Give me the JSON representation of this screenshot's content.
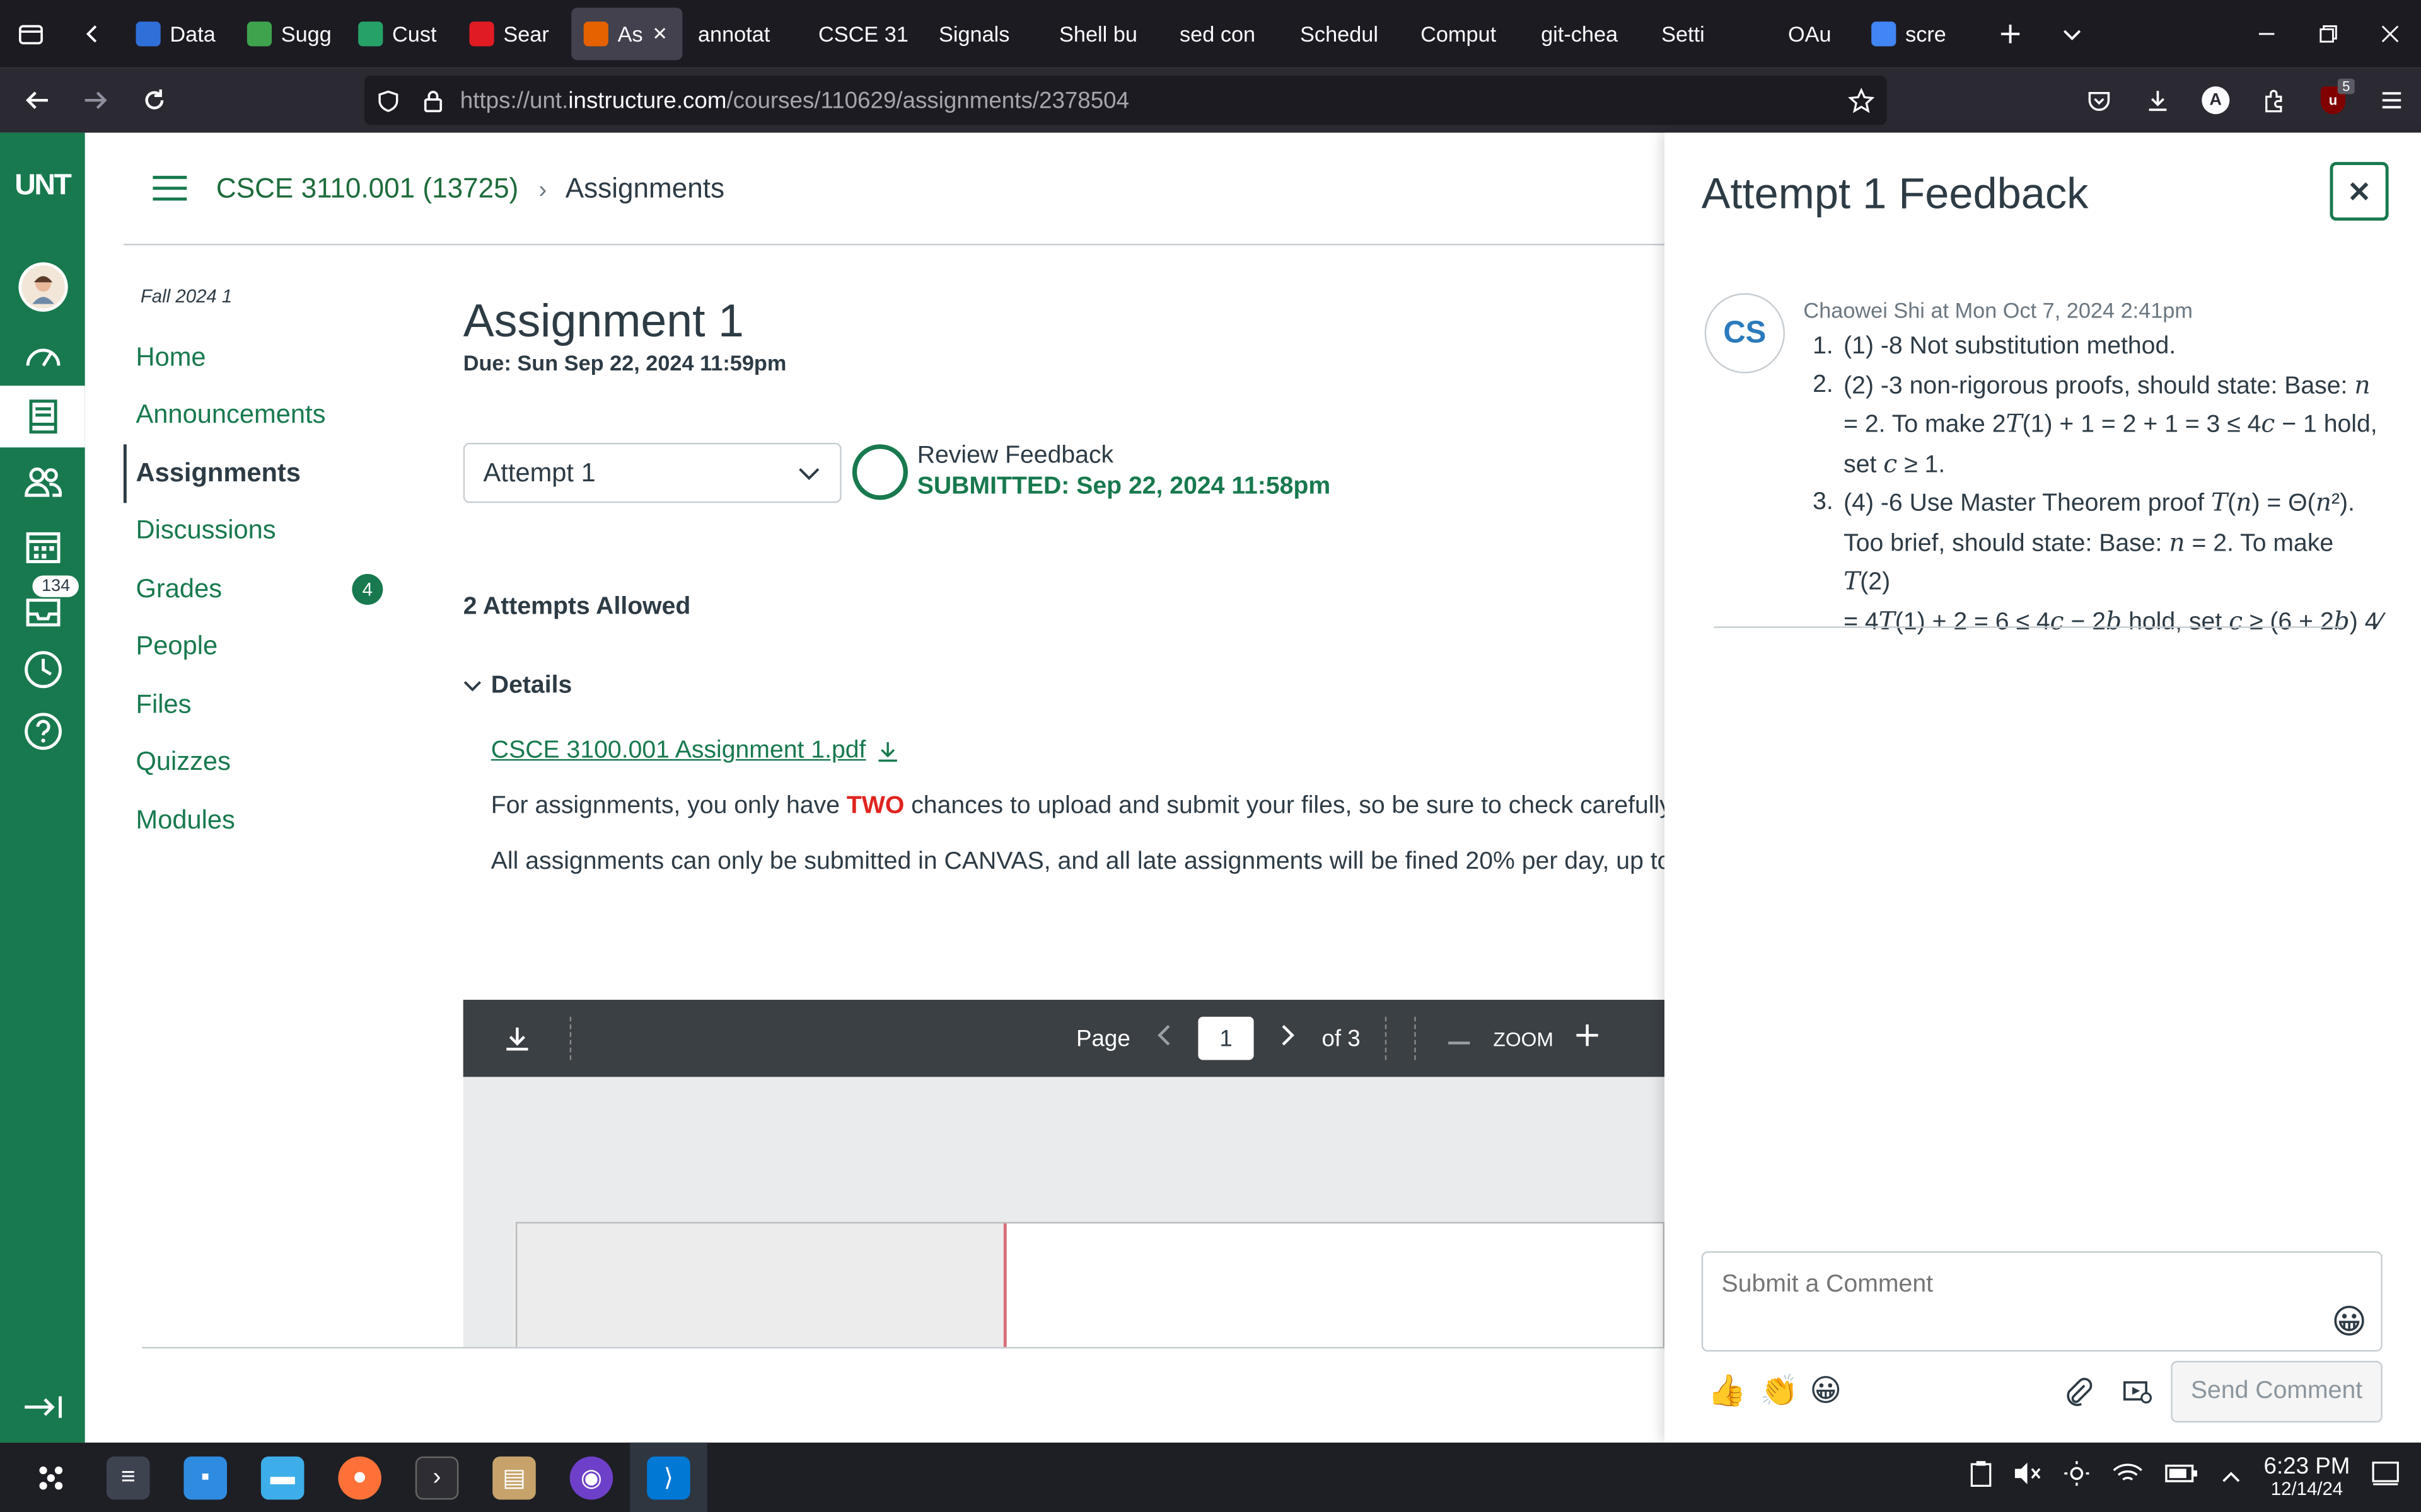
{
  "browser": {
    "tabs": [
      {
        "label": "Data",
        "color": "#2f6fd8"
      },
      {
        "label": "Sugg",
        "color": "#3fa34d"
      },
      {
        "label": "Cust",
        "color": "#26a269"
      },
      {
        "label": "Sear",
        "color": "#e01b24"
      },
      {
        "label": "As",
        "color": "#e66100",
        "active": true
      },
      {
        "label": "annotat",
        "color": ""
      },
      {
        "label": "CSCE 31",
        "color": ""
      },
      {
        "label": "Signals",
        "color": ""
      },
      {
        "label": "Shell bu",
        "color": ""
      },
      {
        "label": "sed con",
        "color": ""
      },
      {
        "label": "Schedul",
        "color": ""
      },
      {
        "label": "Comput",
        "color": ""
      },
      {
        "label": "git-chea",
        "color": ""
      },
      {
        "label": "Setti",
        "color": ""
      },
      {
        "label": "OAu",
        "color": ""
      },
      {
        "label": "scre",
        "color": "#4285f4"
      }
    ],
    "url_prefix": "https://unt.",
    "url_host": "instructure.com",
    "url_path": "/courses/110629/assignments/2378504",
    "notif_count": "5"
  },
  "global_nav": {
    "logo": "UNT",
    "inbox_count": "134"
  },
  "breadcrumb": {
    "course": "CSCE 3110.001 (13725)",
    "separator": "›",
    "page": "Assignments"
  },
  "course_nav": {
    "term": "Fall 2024 1",
    "items": [
      {
        "label": "Home"
      },
      {
        "label": "Announcements"
      },
      {
        "label": "Assignments",
        "active": true
      },
      {
        "label": "Discussions"
      },
      {
        "label": "Grades",
        "badge": "4"
      },
      {
        "label": "People"
      },
      {
        "label": "Files"
      },
      {
        "label": "Quizzes"
      },
      {
        "label": "Modules"
      }
    ]
  },
  "assignment": {
    "title": "Assignment 1",
    "due": "Due: Sun Sep 22, 2024 11:59pm",
    "attempt_select": "Attempt 1",
    "review_label": "Review Feedback",
    "submitted": "SUBMITTED: Sep 22, 2024 11:58pm",
    "attempts_allowed": "2 Attempts Allowed",
    "details_label": "Details",
    "file_link": "CSCE 3100.001 Assignment 1.pdf",
    "para1_pre": "For assignments, you only have ",
    "para1_em": "TWO",
    "para1_post": " chances to upload and submit your files, so be sure to check carefully",
    "para2": "All assignments can only be submitted in CANVAS, and all late assignments will be fined 20% per day, up to"
  },
  "pdf_toolbar": {
    "page_label": "Page",
    "page_value": "1",
    "of_label": "of 3",
    "zoom_label": "ZOOM"
  },
  "feedback": {
    "title": "Attempt 1 Feedback",
    "avatar_initials": "CS",
    "author_line": "Chaowei Shi at Mon Oct 7, 2024 2:41pm",
    "item1": "(1) -8 Not substitution method.",
    "item2a": "(2) -3  non-rigorous proofs, should state: Base: ",
    "item2b": "= 2. To make 2",
    "item2c": "(1) + 1 = 2 + 1 = 3 ≤ 4",
    "item2d": " − 1 hold,",
    "item2e": "set ",
    "item2f": " ≥ 1.",
    "item3a": "(4) -6 Use Master Theorem proof ",
    "item3b": "Too brief, should state: Base: ",
    "item3c": " = 2. To make ",
    "item3d": "= 4",
    "item3e": "(1) + 2 = 6 ≤ 4",
    "item3f": " − 2",
    "item3g": " hold, set ",
    "item3h": " ≥ (6 + 2",
    "item3i": ") 4⁄",
    "comment_placeholder": "Submit a Comment",
    "send_label": "Send Comment"
  },
  "taskbar": {
    "time": "6:23 PM",
    "date": "12/14/24"
  }
}
